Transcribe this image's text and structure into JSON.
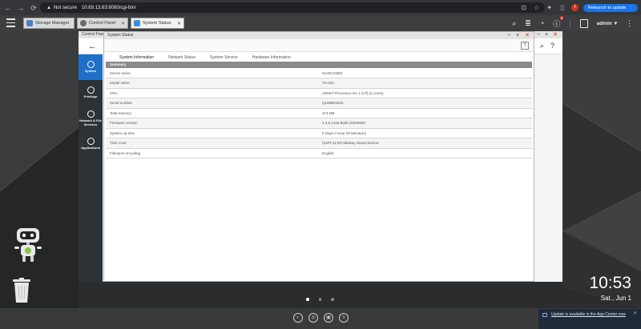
{
  "browser": {
    "security_label": "Not secure",
    "url": "10.69.13.63:8080/cgi-bin/",
    "profile_initial": "I",
    "relaunch_label": "Relaunch to update"
  },
  "taskbar": {
    "tabs": [
      {
        "label": "Storage Manager",
        "color": "#4a7fc1"
      },
      {
        "label": "Control Panel",
        "color": "#6b6b6b"
      },
      {
        "label": "System Status",
        "color": "#3b8fd9"
      }
    ],
    "notification_count": "6",
    "user": "admin"
  },
  "control_panel": {
    "title": "Control Panel",
    "sidebar": [
      {
        "label": "System"
      },
      {
        "label": "Privilege"
      },
      {
        "label": "Network & File Services"
      },
      {
        "label": "Applications"
      }
    ]
  },
  "system_status": {
    "title": "System Status",
    "tabs": [
      "System Information",
      "Network Status",
      "System Service",
      "Hardware Information"
    ],
    "summary_header": "Summary",
    "rows": [
      {
        "key": "Server name",
        "value": "NASEA0383"
      },
      {
        "key": "Model name",
        "value": "TS-231"
      },
      {
        "key": "CPU",
        "value": "ARMv7 Processor rev 1 (v7l) (2 cores)"
      },
      {
        "key": "Serial number",
        "value": "Q158B03316"
      },
      {
        "key": "Total memory",
        "value": "474 MB"
      },
      {
        "key": "Firmware version",
        "value": "4.3.6.1446 Build 20200929"
      },
      {
        "key": "System up time",
        "value": "0 Days 0 Hour 50 Minute(s)"
      },
      {
        "key": "Time zone",
        "value": "(GMT-11:00) Midway Island,Samoa"
      },
      {
        "key": "Filename encoding",
        "value": "English"
      }
    ]
  },
  "desktop": {
    "time": "10:53",
    "date": "Sat., Jun 1"
  },
  "notification": {
    "text": "Update is available in the App Center now"
  }
}
